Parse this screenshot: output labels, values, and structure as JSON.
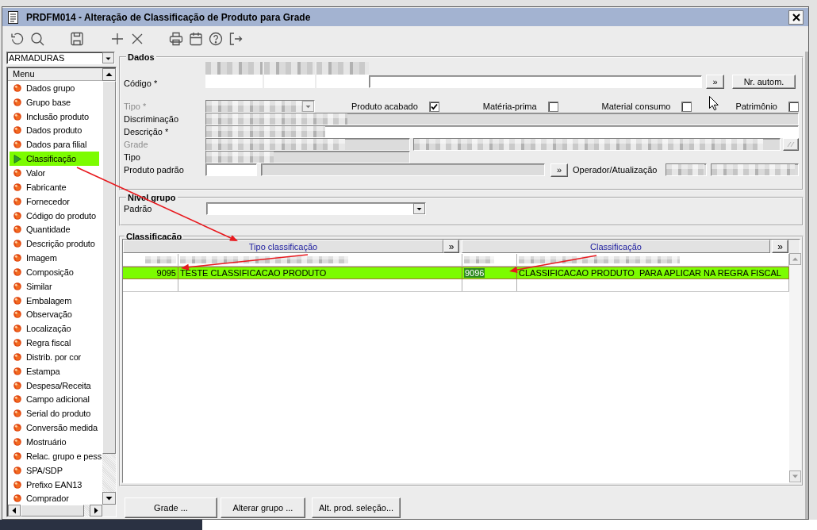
{
  "window": {
    "title": "PRDFM014 - Alteração de Classificação de Produto para Grade"
  },
  "sidebar": {
    "company": {
      "value": "ARMADURAS"
    },
    "header": "Menu",
    "items": [
      {
        "label": "Dados grupo",
        "selected": false
      },
      {
        "label": "Grupo base",
        "selected": false
      },
      {
        "label": "Inclusão produto",
        "selected": false
      },
      {
        "label": "Dados produto",
        "selected": false
      },
      {
        "label": "Dados para filial",
        "selected": false
      },
      {
        "label": "Classificação",
        "selected": true
      },
      {
        "label": "Valor",
        "selected": false
      },
      {
        "label": "Fabricante",
        "selected": false
      },
      {
        "label": "Fornecedor",
        "selected": false
      },
      {
        "label": "Código do produto",
        "selected": false
      },
      {
        "label": "Quantidade",
        "selected": false
      },
      {
        "label": "Descrição produto",
        "selected": false
      },
      {
        "label": "Imagem",
        "selected": false
      },
      {
        "label": "Composição",
        "selected": false
      },
      {
        "label": "Similar",
        "selected": false
      },
      {
        "label": "Embalagem",
        "selected": false
      },
      {
        "label": "Observação",
        "selected": false
      },
      {
        "label": "Localização",
        "selected": false
      },
      {
        "label": "Regra fiscal",
        "selected": false
      },
      {
        "label": "Distrib. por cor",
        "selected": false
      },
      {
        "label": "Estampa",
        "selected": false
      },
      {
        "label": "Despesa/Receita",
        "selected": false
      },
      {
        "label": "Campo adicional",
        "selected": false
      },
      {
        "label": "Serial do produto",
        "selected": false
      },
      {
        "label": "Conversão medida",
        "selected": false
      },
      {
        "label": "Mostruário",
        "selected": false
      },
      {
        "label": "Relac. grupo e pess",
        "selected": false
      },
      {
        "label": "SPA/SDP",
        "selected": false
      },
      {
        "label": "Prefixo EAN13",
        "selected": false
      },
      {
        "label": "Comprador",
        "selected": false
      }
    ]
  },
  "dados": {
    "legend": "Dados",
    "codigo": {
      "label": "Código *",
      "redacted": true,
      "lookup_button": "»",
      "auto_button": "Nr. autom."
    },
    "tipo": {
      "label": "Tipo *",
      "disabled": true,
      "redacted": true
    },
    "flags": [
      {
        "label": "Produto acabado",
        "checked": true
      },
      {
        "label": "Matéria-prima",
        "checked": false
      },
      {
        "label": "Material consumo",
        "checked": false
      },
      {
        "label": "Patrimônio",
        "checked": false
      }
    ],
    "discriminacao": {
      "label": "Discriminação",
      "redacted": true
    },
    "descricao": {
      "label": "Descrição *",
      "redacted": true
    },
    "grade": {
      "label": "Grade",
      "disabled": true,
      "redacted": true
    },
    "tipo_produto": {
      "label": "Tipo",
      "redacted": true
    },
    "produto_padrao": {
      "label": "Produto padrão",
      "lookup_button": "»"
    },
    "operador": {
      "label": "Operador/Atualização",
      "redacted": true
    }
  },
  "nivel_grupo": {
    "legend": "Nível grupo",
    "padrao": {
      "label": "Padrão"
    }
  },
  "classificacao": {
    "legend": "Classificação",
    "columns": [
      {
        "label": "Tipo classificação",
        "button": "»"
      },
      {
        "label": "Classificação",
        "button": "»"
      }
    ],
    "rows": [
      {
        "redacted": true,
        "selected": false
      },
      {
        "selected": true,
        "cells": [
          {
            "text": "9095",
            "focused": false
          },
          {
            "text": "TESTE CLASSIFICACAO PRODUTO",
            "focused": false
          },
          {
            "text": "9096",
            "focused": true
          },
          {
            "text": "CLASSIFICACAO PRODUTO  PARA APLICAR NA REGRA FISCAL",
            "focused": false
          }
        ]
      },
      {
        "selected": false
      }
    ]
  },
  "buttons": [
    "Grade ...",
    "Alterar grupo ...",
    "Alt. prod. seleção..."
  ]
}
